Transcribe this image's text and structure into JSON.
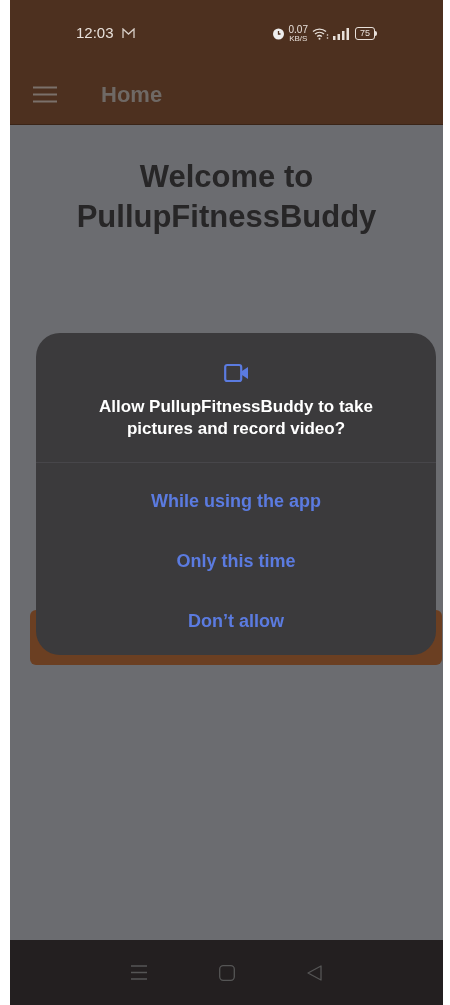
{
  "status_bar": {
    "time": "12:03",
    "net_speed": "0.07",
    "net_unit": "KB/S",
    "battery": "75"
  },
  "app_bar": {
    "title": "Home"
  },
  "welcome": {
    "title": "Welcome to PullupFitnessBuddy"
  },
  "dialog": {
    "title": "Allow PullupFitnessBuddy to take pictures and record video?",
    "options": [
      "While using the app",
      "Only this time",
      "Don’t allow"
    ]
  }
}
